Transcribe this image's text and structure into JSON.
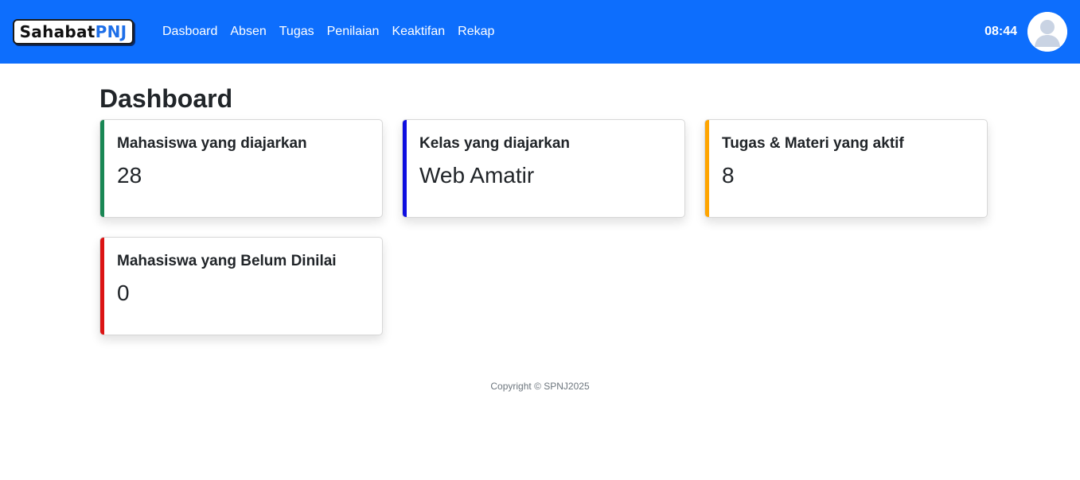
{
  "brand": {
    "part1": "Sahabat",
    "part2": "PNJ"
  },
  "nav": {
    "items": [
      {
        "label": "Dasboard"
      },
      {
        "label": "Absen"
      },
      {
        "label": "Tugas"
      },
      {
        "label": "Penilaian"
      },
      {
        "label": "Keaktifan"
      },
      {
        "label": "Rekap"
      }
    ],
    "time": "08:44"
  },
  "page": {
    "title": "Dashboard"
  },
  "cards": [
    {
      "label": "Mahasiswa yang diajarkan",
      "value": "28",
      "color": "#198754"
    },
    {
      "label": "Kelas yang diajarkan",
      "value": "Web Amatir",
      "color": "#0d0de0"
    },
    {
      "label": "Tugas & Materi yang aktif",
      "value": "8",
      "color": "#ffa500"
    },
    {
      "label": "Mahasiswa yang Belum Dinilai",
      "value": "0",
      "color": "#dc1414"
    }
  ],
  "footer": {
    "copyright": "Copyright © SPNJ2025"
  },
  "colors": {
    "navbar": "#0d6efd",
    "brand_accent": "#1e6fe8"
  },
  "icons": {
    "avatar": "user-avatar-icon"
  }
}
